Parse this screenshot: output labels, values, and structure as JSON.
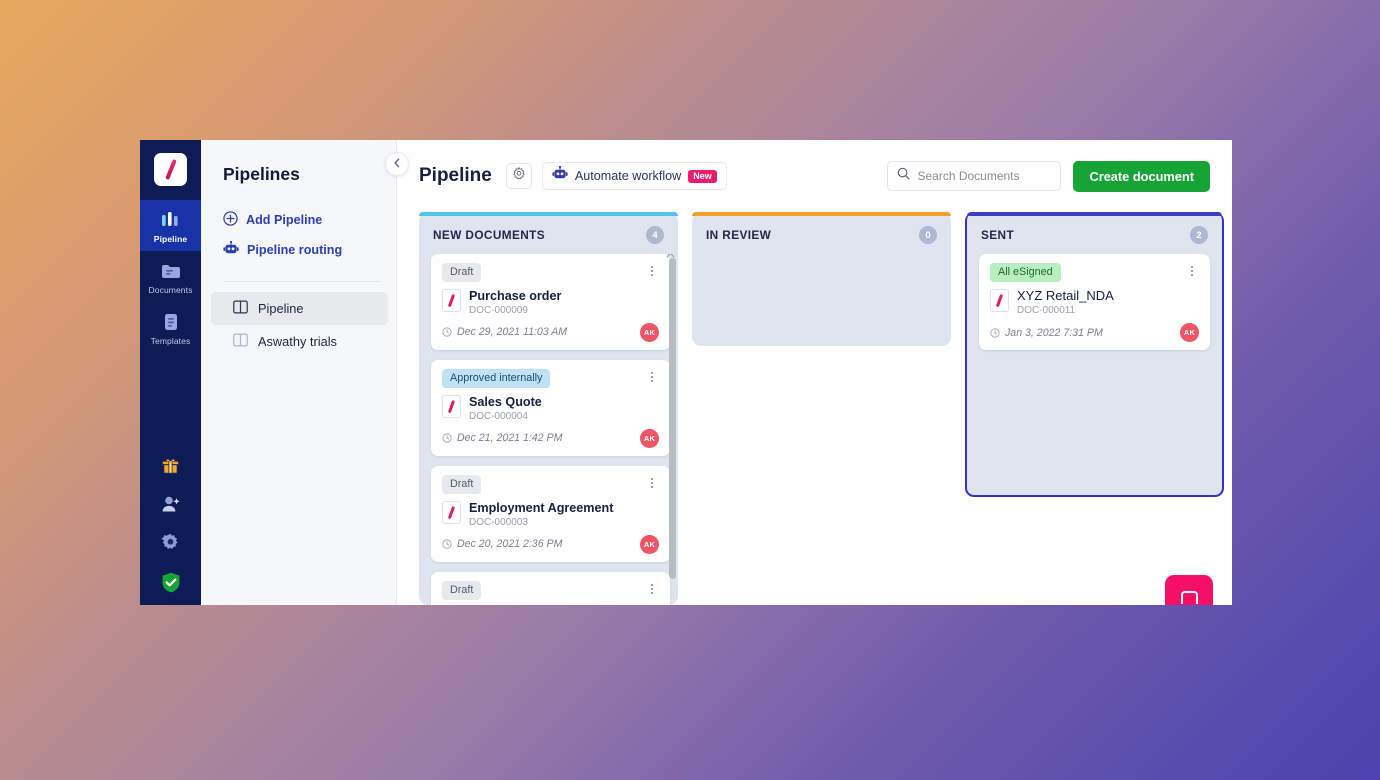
{
  "rail": {
    "logo_icon": "logo-slash-icon",
    "items": [
      {
        "label": "Pipeline",
        "icon": "pipeline-icon",
        "active": true
      },
      {
        "label": "Documents",
        "icon": "documents-icon",
        "active": false
      },
      {
        "label": "Templates",
        "icon": "templates-icon",
        "active": false
      }
    ],
    "bottom_icons": [
      "gift-icon",
      "add-user-icon",
      "gear-icon",
      "shield-check-icon"
    ]
  },
  "sidebar": {
    "title": "Pipelines",
    "actions": [
      {
        "label": "Add Pipeline",
        "icon": "plus-circle-icon"
      },
      {
        "label": "Pipeline routing",
        "icon": "robot-icon"
      }
    ],
    "items": [
      {
        "label": "Pipeline",
        "icon": "board-icon",
        "active": true
      },
      {
        "label": "Aswathy trials",
        "icon": "board-icon",
        "active": false
      }
    ],
    "collapse_icon": "chevron-left-icon"
  },
  "topbar": {
    "title": "Pipeline",
    "settings_icon": "gear-icon",
    "automate_label": "Automate workflow",
    "automate_icon": "robot-icon",
    "automate_badge": "New",
    "search": {
      "placeholder": "Search Documents",
      "value": "",
      "icon": "search-icon"
    },
    "create_label": "Create document"
  },
  "colors": {
    "accent_new": "#4fc3ec",
    "accent_review": "#f2a029",
    "accent_sent": "#3c3fc4",
    "create_green": "#17a437",
    "badge_pink": "#ef1a6e",
    "avatar_red": "#ef5565"
  },
  "board": {
    "columns": [
      {
        "title": "NEW DOCUMENTS",
        "count": "4",
        "accent": "#4fc3ec",
        "has_scrollbar": true,
        "cards": [
          {
            "status": "Draft",
            "status_type": "draft",
            "title": "Purchase order",
            "doc_id": "DOC-000009",
            "date": "Dec 29, 2021 11:03 AM",
            "avatar": "AK",
            "title_bold": true
          },
          {
            "status": "Approved internally",
            "status_type": "approved",
            "title": "Sales Quote",
            "doc_id": "DOC-000004",
            "date": "Dec 21, 2021 1:42 PM",
            "avatar": "AK",
            "title_bold": true
          },
          {
            "status": "Draft",
            "status_type": "draft",
            "title": "Employment Agreement",
            "doc_id": "DOC-000003",
            "date": "Dec 20, 2021 2:36 PM",
            "avatar": "AK",
            "title_bold": true
          },
          {
            "status": "Draft",
            "status_type": "draft",
            "title": "",
            "doc_id": "",
            "date": "",
            "avatar": "",
            "title_bold": true
          }
        ]
      },
      {
        "title": "IN REVIEW",
        "count": "0",
        "accent": "#f2a029",
        "has_scrollbar": false,
        "cards": []
      },
      {
        "title": "SENT",
        "count": "2",
        "accent": "#3c3fc4",
        "has_scrollbar": false,
        "highlighted": true,
        "cards": [
          {
            "status": "All eSigned",
            "status_type": "esigned",
            "title": "XYZ Retail_NDA",
            "doc_id": "DOC-000011",
            "date": "Jan 3, 2022 7:31 PM",
            "avatar": "AK",
            "title_bold": false
          }
        ]
      }
    ]
  },
  "chat": {
    "icon": "chat-bubble-icon"
  }
}
